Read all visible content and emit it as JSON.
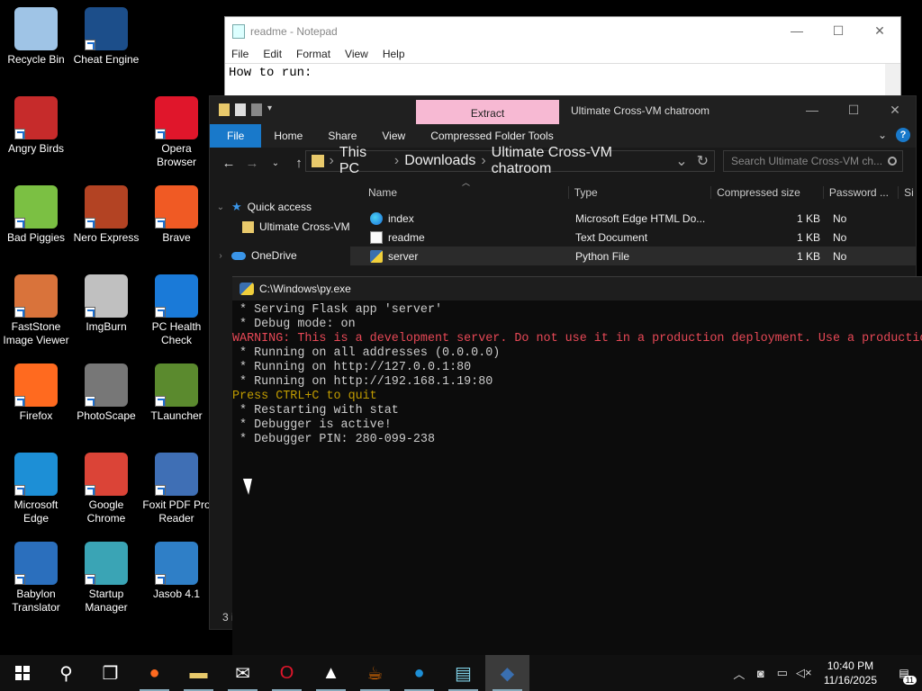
{
  "desktop": {
    "icons": [
      {
        "label": "Recycle Bin",
        "color": "#9fc4e6"
      },
      {
        "label": "Cheat Engine",
        "color": "#1c4e8a"
      },
      {
        "label": "Angry Birds",
        "color": "#c62b2b"
      },
      {
        "label": "Opera Browser",
        "color": "#e0162b"
      },
      {
        "label": "Bad Piggies",
        "color": "#7bc043"
      },
      {
        "label": "Nero Express",
        "color": "#b34323"
      },
      {
        "label": "Brave",
        "color": "#f05a24"
      },
      {
        "label": "FastStone Image Viewer",
        "color": "#d9733b"
      },
      {
        "label": "ImgBurn",
        "color": "#c0c0c0"
      },
      {
        "label": "PC Health Check",
        "color": "#1a7ad8"
      },
      {
        "label": "Firefox",
        "color": "#ff6a1f"
      },
      {
        "label": "PhotoScape",
        "color": "#777777"
      },
      {
        "label": "TLauncher",
        "color": "#5b8a2e"
      },
      {
        "label": "Microsoft Edge",
        "color": "#1d8fd6"
      },
      {
        "label": "Google Chrome",
        "color": "#db4437"
      },
      {
        "label": "Foxit PDF Pro Reader",
        "color": "#3f6fb5"
      },
      {
        "label": "Babylon Translator",
        "color": "#2b6fbd"
      },
      {
        "label": "Startup Manager",
        "color": "#3aa4b5"
      },
      {
        "label": "Jasob 4.1",
        "color": "#2f7fc7"
      }
    ]
  },
  "notepad": {
    "title": "readme - Notepad",
    "menu": [
      "File",
      "Edit",
      "Format",
      "View",
      "Help"
    ],
    "content": "How to run:",
    "controls": [
      "—",
      "☐",
      "✕"
    ]
  },
  "explorer": {
    "extract_tab": "Extract",
    "title": "Ultimate Cross-VM chatroom",
    "controls": [
      "—",
      "☐",
      "✕"
    ],
    "ribbon_tabs": [
      "File",
      "Home",
      "Share",
      "View",
      "Compressed Folder Tools"
    ],
    "breadcrumb": [
      "This PC",
      "Downloads",
      "Ultimate Cross-VM chatroom"
    ],
    "search_placeholder": "Search Ultimate Cross-VM ch...",
    "nav": {
      "quick_access": "Quick access",
      "folder": "Ultimate Cross-VM",
      "onedrive": "OneDrive"
    },
    "columns": [
      "Name",
      "Type",
      "Compressed size",
      "Password ...",
      "Si"
    ],
    "files": [
      {
        "name": "index",
        "type": "Microsoft Edge HTML Do...",
        "size": "1 KB",
        "password": "No"
      },
      {
        "name": "readme",
        "type": "Text Document",
        "size": "1 KB",
        "password": "No"
      },
      {
        "name": "server",
        "type": "Python File",
        "size": "1 KB",
        "password": "No"
      }
    ],
    "status": "3 i"
  },
  "console": {
    "title": "C:\\Windows\\py.exe",
    "lines": [
      {
        "text": " * Serving Flask app 'server'",
        "kind": "normal"
      },
      {
        "text": " * Debug mode: on",
        "kind": "normal"
      },
      {
        "text": "WARNING: This is a development server. Do not use it in a production deployment. Use a productio",
        "kind": "warn"
      },
      {
        "text": " * Running on all addresses (0.0.0.0)",
        "kind": "normal"
      },
      {
        "text": " * Running on http://127.0.0.1:80",
        "kind": "normal"
      },
      {
        "text": " * Running on http://192.168.1.19:80",
        "kind": "normal"
      },
      {
        "text": "Press CTRL+C to quit",
        "kind": "yellow"
      },
      {
        "text": " * Restarting with stat",
        "kind": "normal"
      },
      {
        "text": " * Debugger is active!",
        "kind": "normal"
      },
      {
        "text": " * Debugger PIN: 280-099-238",
        "kind": "normal"
      }
    ]
  },
  "taskbar": {
    "apps": [
      {
        "name": "search-icon",
        "glyph": "⚲"
      },
      {
        "name": "task-view-icon",
        "glyph": "❐"
      },
      {
        "name": "firefox-icon",
        "glyph": "●",
        "color": "#ff6a1f"
      },
      {
        "name": "file-explorer-icon",
        "glyph": "▬",
        "color": "#e8c96b"
      },
      {
        "name": "mail-icon",
        "glyph": "✉"
      },
      {
        "name": "opera-icon",
        "glyph": "O",
        "color": "#e0162b"
      },
      {
        "name": "photos-icon",
        "glyph": "▲"
      },
      {
        "name": "java-icon",
        "glyph": "☕",
        "color": "#e76f00"
      },
      {
        "name": "edge-icon",
        "glyph": "●",
        "color": "#1d8fd6"
      },
      {
        "name": "notepad-icon",
        "glyph": "▤",
        "color": "#7fd0e6"
      },
      {
        "name": "python-icon",
        "glyph": "◆",
        "color": "#3a6fb0"
      }
    ],
    "time": "10:40 PM",
    "date": "11/16/2025",
    "notification_count": "11"
  }
}
